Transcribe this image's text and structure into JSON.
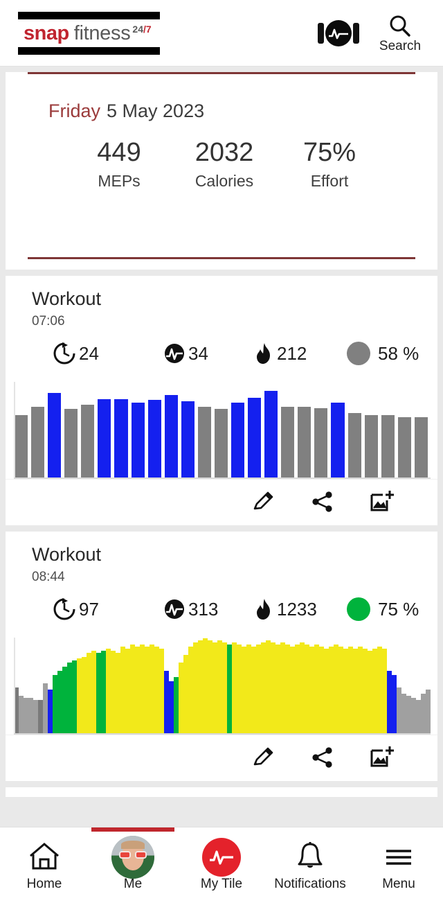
{
  "header": {
    "logo": {
      "word1": "snap",
      "word2": "fitness",
      "sup": "24",
      "sup_slash": "/7"
    },
    "myzone_icon": "myzone-heartbeat-icon",
    "search_label": "Search"
  },
  "summary": {
    "day": "Friday",
    "date": "5 May 2023",
    "stats": [
      {
        "value": "449",
        "label": "MEPs"
      },
      {
        "value": "2032",
        "label": "Calories"
      },
      {
        "value": "75%",
        "label": "Effort"
      }
    ]
  },
  "workouts": [
    {
      "title": "Workout",
      "time": "07:06",
      "duration": "24",
      "meps": "34",
      "calories": "212",
      "effort": "58 %",
      "effort_color": "#808080",
      "actions": {
        "edit": "edit-pencil-icon",
        "share": "share-icon",
        "photo": "add-photo-icon"
      }
    },
    {
      "title": "Workout",
      "time": "08:44",
      "duration": "97",
      "meps": "313",
      "calories": "1233",
      "effort": "75 %",
      "effort_color": "#00b33c",
      "actions": {
        "edit": "edit-pencil-icon",
        "share": "share-icon",
        "photo": "add-photo-icon"
      }
    }
  ],
  "chart_data": [
    {
      "type": "bar",
      "title": "Workout 07:06 heart-rate zone bars",
      "xlabel": "",
      "ylabel": "",
      "ylim": [
        0,
        100
      ],
      "zone_colors": {
        "gray": "#808080",
        "blue": "#1420ef",
        "green": "#00b33c",
        "yellow": "#f2e91a"
      },
      "values": [
        62,
        70,
        84,
        68,
        72,
        78,
        78,
        74,
        77,
        82,
        76,
        70,
        68,
        74,
        79,
        86,
        70,
        70,
        69,
        74,
        64,
        62,
        62,
        60,
        60
      ],
      "colors": [
        "gray",
        "gray",
        "blue",
        "gray",
        "gray",
        "blue",
        "blue",
        "blue",
        "blue",
        "blue",
        "blue",
        "gray",
        "gray",
        "blue",
        "blue",
        "blue",
        "gray",
        "gray",
        "gray",
        "blue",
        "gray",
        "gray",
        "gray",
        "gray",
        "gray"
      ]
    },
    {
      "type": "bar",
      "title": "Workout 08:44 heart-rate zone bars",
      "xlabel": "",
      "ylabel": "",
      "ylim": [
        0,
        100
      ],
      "zone_colors": {
        "gray": "#a0a0a0",
        "gray_dark": "#7a7a7a",
        "blue": "#1420ef",
        "green": "#00b33c",
        "yellow": "#f2e91a"
      },
      "values": [
        46,
        38,
        36,
        36,
        34,
        34,
        50,
        44,
        58,
        62,
        66,
        70,
        72,
        74,
        76,
        80,
        82,
        80,
        82,
        84,
        82,
        80,
        86,
        84,
        88,
        86,
        88,
        86,
        88,
        86,
        84,
        62,
        52,
        56,
        70,
        78,
        86,
        90,
        92,
        94,
        92,
        90,
        92,
        90,
        88,
        90,
        88,
        86,
        88,
        86,
        88,
        90,
        92,
        90,
        88,
        90,
        88,
        86,
        88,
        90,
        88,
        86,
        88,
        86,
        84,
        86,
        88,
        86,
        84,
        86,
        84,
        86,
        84,
        82,
        84,
        86,
        84,
        62,
        58,
        46,
        40,
        38,
        36,
        34,
        40,
        44
      ],
      "colors": [
        "gray_dark",
        "gray",
        "gray",
        "gray",
        "gray",
        "gray_dark",
        "gray",
        "blue",
        "green",
        "green",
        "green",
        "green",
        "green",
        "yellow",
        "yellow",
        "yellow",
        "yellow",
        "green",
        "green",
        "yellow",
        "yellow",
        "yellow",
        "yellow",
        "yellow",
        "yellow",
        "yellow",
        "yellow",
        "yellow",
        "yellow",
        "yellow",
        "yellow",
        "blue",
        "blue",
        "green",
        "yellow",
        "yellow",
        "yellow",
        "yellow",
        "yellow",
        "yellow",
        "yellow",
        "yellow",
        "yellow",
        "yellow",
        "green",
        "yellow",
        "yellow",
        "yellow",
        "yellow",
        "yellow",
        "yellow",
        "yellow",
        "yellow",
        "yellow",
        "yellow",
        "yellow",
        "yellow",
        "yellow",
        "yellow",
        "yellow",
        "yellow",
        "yellow",
        "yellow",
        "yellow",
        "yellow",
        "yellow",
        "yellow",
        "yellow",
        "yellow",
        "yellow",
        "yellow",
        "yellow",
        "yellow",
        "yellow",
        "yellow",
        "yellow",
        "yellow",
        "blue",
        "blue",
        "gray",
        "gray",
        "gray",
        "gray",
        "gray",
        "gray",
        "gray"
      ]
    }
  ],
  "nav": {
    "items": [
      {
        "label": "Home",
        "icon": "home-icon",
        "active": false
      },
      {
        "label": "Me",
        "icon": "avatar",
        "active": true
      },
      {
        "label": "My Tile",
        "icon": "mytile-icon",
        "active": false
      },
      {
        "label": "Notifications",
        "icon": "bell-icon",
        "active": false
      },
      {
        "label": "Menu",
        "icon": "hamburger-icon",
        "active": false
      }
    ]
  }
}
